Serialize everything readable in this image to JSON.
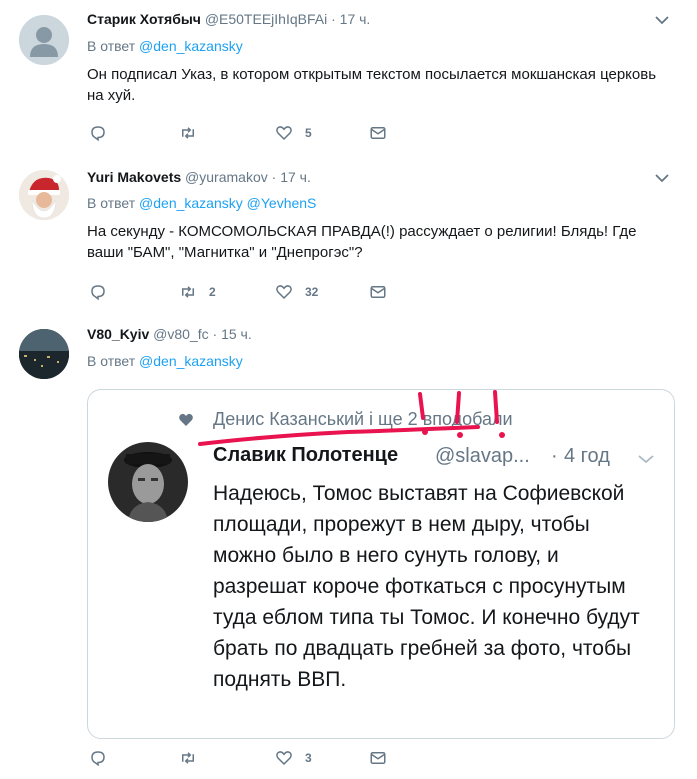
{
  "tweets": [
    {
      "name": "Старик Хотябыч",
      "handle": "@E50TEEjIhIqBFAi",
      "dot": "·",
      "time": "17 ч.",
      "reply_prefix": "В ответ",
      "mentions": [
        "@den_kazansky"
      ],
      "text": "Он подписал Указ, в котором открытым текстом посылается мокшанская церковь на хуй.",
      "actions": {
        "reply": "",
        "retweet": "",
        "like": "5"
      }
    },
    {
      "name": "Yuri Makovets",
      "handle": "@yuramakov",
      "dot": "·",
      "time": "17 ч.",
      "reply_prefix": "В ответ",
      "mentions": [
        "@den_kazansky",
        "@YevhenS"
      ],
      "text": "На секунду - КОМСОМОЛЬСКАЯ ПРАВДА(!) рассуждает о религии! Блядь! Где ваши \"БАМ\", \"Магнитка\" и \"Днепрогэс\"?",
      "actions": {
        "reply": "",
        "retweet": "2",
        "like": "32"
      }
    },
    {
      "name": "V80_Kyiv",
      "handle": "@v80_fc",
      "dot": "·",
      "time": "15 ч.",
      "reply_prefix": "В ответ",
      "mentions": [
        "@den_kazansky"
      ],
      "media": {
        "liked_by": "Денис Казанський і ще 2 вподобали",
        "name": "Славик Полотенце",
        "handle": "@slavap...",
        "dot": "·",
        "time": "4 год",
        "text": "Надеюсь, Томос выставят на Софиевской площади, прорежут в нем дыру, чтобы можно было в него сунуть голову, и разрешат короче фоткаться с просунутым туда еблом типа ты Томос. И конечно будут брать по двадцать гребней за фото, чтобы поднять ВВП."
      },
      "actions": {
        "reply": "",
        "retweet": "",
        "like": "3"
      }
    }
  ],
  "icons": {
    "reply": "reply-icon",
    "retweet": "retweet-icon",
    "like": "heart-icon",
    "dm": "envelope-icon",
    "caret": "chevron-down-icon"
  },
  "colors": {
    "link": "#1da1f2",
    "secondary": "#657786",
    "text": "#14171a",
    "border": "#e6ecf0",
    "annotation": "#e8134f"
  }
}
